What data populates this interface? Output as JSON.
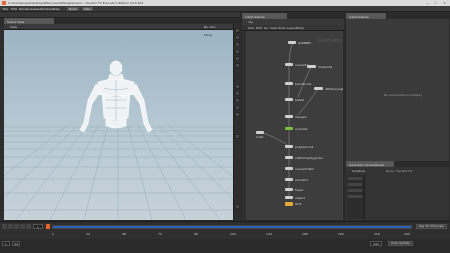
{
  "window": {
    "title": "C:/Users/Jorge/Desktop/Kitten Jaw/KittenJaw.hipnc - Houdini FX Education Edition 19.5.303",
    "minimize": "—",
    "maximize": "☐",
    "close": "✕"
  },
  "menubar": {
    "items": [
      "File",
      "Edit",
      "Render",
      "Assets",
      "Windows",
      "Help"
    ],
    "desktop": "Build",
    "workspace": "Main"
  },
  "viewport": {
    "tab_label": "Scene View",
    "view_mode": "View",
    "camera_label": "Persp",
    "cam_dropdown": "No cam"
  },
  "network": {
    "tab_label": "/obj/Creature",
    "path": "obj",
    "menu_items": [
      "Add",
      "Edit",
      "Go",
      "View",
      "Tools",
      "Layout",
      "Help"
    ],
    "context_label": "Geometry",
    "nodes": [
      {
        "label": "ALEMBIC"
      },
      {
        "label": "convert1"
      },
      {
        "label": "transform1"
      },
      {
        "label": "blast1"
      },
      {
        "label": "merge1"
      },
      {
        "label": "normal1"
      },
      {
        "label": "null1"
      },
      {
        "label": "polyreduce1"
      },
      {
        "label": "vdbfrompolygons1"
      },
      {
        "label": "convertvdb1"
      },
      {
        "label": "smooth1"
      },
      {
        "label": "fuse1"
      },
      {
        "label": "clean1"
      },
      {
        "label": "OUT"
      }
    ],
    "side_nodes": [
      {
        "label": "material1"
      },
      {
        "label": "attribwrangle1"
      }
    ]
  },
  "params": {
    "tab_label": "/obj/Creature",
    "empty_text": "No parameters to display"
  },
  "spreadsheet": {
    "tab_label": "Geometry Spreadsheet",
    "node_name": "Creature",
    "info": "Node: transform1"
  },
  "timeline": {
    "frame": "1",
    "start": "1",
    "end": "240",
    "fps": "24",
    "ticks": [
      "1",
      "24",
      "48",
      "72",
      "96",
      "120",
      "144",
      "168",
      "192",
      "216",
      "240"
    ],
    "key_all": "Key All Channels",
    "auto_update": "Auto Update"
  },
  "colors": {
    "accent_orange": "#e8622d",
    "timeline_blue": "#2f6fd6",
    "node_green": "#76c043"
  }
}
